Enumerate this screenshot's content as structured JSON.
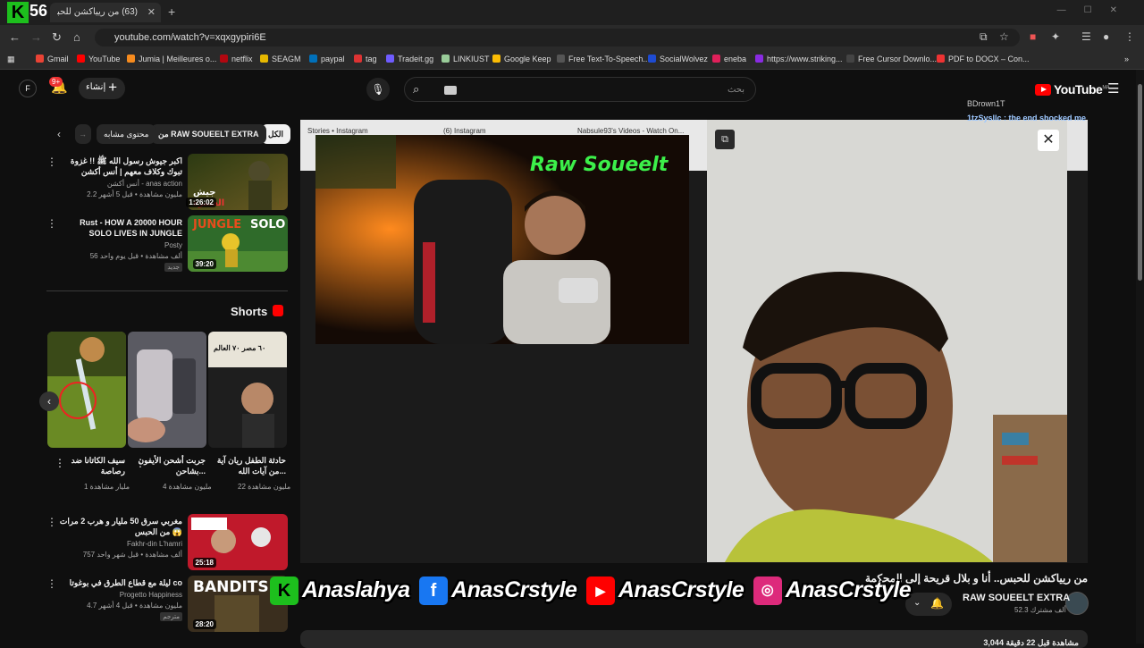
{
  "browser": {
    "tab_title": "(63) من ريياكشن للحبس.. أنا و بلال قريحة إلى المحكمة",
    "tab_close": "✕",
    "new_tab": "+",
    "url": "youtube.com/watch?v=xqxgypiri6E",
    "bookmarks": [
      "Gmail",
      "YouTube",
      "Jumia | Meilleures o...",
      "netflix",
      "SEAGM",
      "paypal",
      "tag",
      "Tradeit.gg",
      "LINKIUST",
      "Google Keep",
      "Free Text-To-Speech...",
      "SocialWolvez",
      "eneba",
      "https://www.striking...",
      "Free Cursor Downlo...",
      "PDF to DOCX – Con..."
    ],
    "logo_letter": "K",
    "logo_number": "56"
  },
  "header": {
    "avatar_letter": "F",
    "notif_count": "9+",
    "create_label": "إنشاء",
    "search_placeholder": "بحث",
    "logo_text": "YouTube",
    "logo_region": "MA"
  },
  "chips": {
    "all": "الكل",
    "from_channel": "من RAW SOUEELT EXTRA",
    "similar": "محتوى مشابه"
  },
  "related": [
    {
      "title": "اكبر جيوش رسول الله ﷺ !! غزوة تبوك وكلاف معهم | أنس أكشن",
      "channel": "أنس أكشن - anas action",
      "meta": "2.2 مليون مشاهدة • قبل 5 أشهر",
      "duration": "1:26:02"
    },
    {
      "title": "Rust - HOW A 20000 HOUR SOLO LIVES IN JUNGLE",
      "channel": "Posty",
      "meta": "56 ألف مشاهدة • قبل يوم واحد",
      "duration": "39:20",
      "tag": "جديد"
    },
    {
      "title": "مغربي سرق 50 مليار و هرب 2 مرات من الحبس 😱",
      "channel": "Fakhr-din L'hamri",
      "meta": "757 ألف مشاهدة • قبل شهر واحد",
      "duration": "25:18"
    },
    {
      "title": "ليلة مع قطاع الطرق في بوغوتا co",
      "channel": "Progetto Happiness",
      "meta": "4.7 مليون مشاهدة • قبل 4 أشهر",
      "duration": "28:20",
      "tag": "مترجم"
    }
  ],
  "shorts": {
    "heading": "Shorts",
    "items": [
      {
        "title": "حادثة الطفل ريان آية من آيات الله...",
        "views": "22 مليون مشاهدة",
        "overlay": "٦٠ مصر ٧٠ العالم"
      },
      {
        "title": "جربت أشحن الأيفون بشاحن...",
        "views": "4 مليون مشاهدة"
      },
      {
        "title": "سيف الكاتانا ضد رصاصة",
        "views": "1 مليار مشاهدة"
      }
    ]
  },
  "stream": {
    "inner_tabs": [
      "Stories • Instagram",
      "(6) Instagram",
      "Nabsule93's Videos - Watch On..."
    ],
    "neon_sign": "Raw Soueelt",
    "chat_user": "BDrown1T",
    "chat_line": "1tzSysllc : the end shocked me"
  },
  "video": {
    "title": "من ريياكشن للحبس.. أنا و بلال قريحة إلى المحكمة",
    "channel": "RAW SOUEELT EXTRA",
    "subscribers": "52.3 ألف مشترك",
    "description": "3,044 مشاهدة قبل 22 دقيقة"
  },
  "watermark": {
    "handle1": "Anaslahya",
    "handle2": "AnasCrstyle",
    "handle3": "AnasCrstyle",
    "handle4": "AnasCrstyle"
  },
  "colors": {
    "yt_red": "#ff0000",
    "kick_green": "#1dbf1d",
    "facebook": "#1877f2",
    "instagram": "#dd2a7b"
  }
}
